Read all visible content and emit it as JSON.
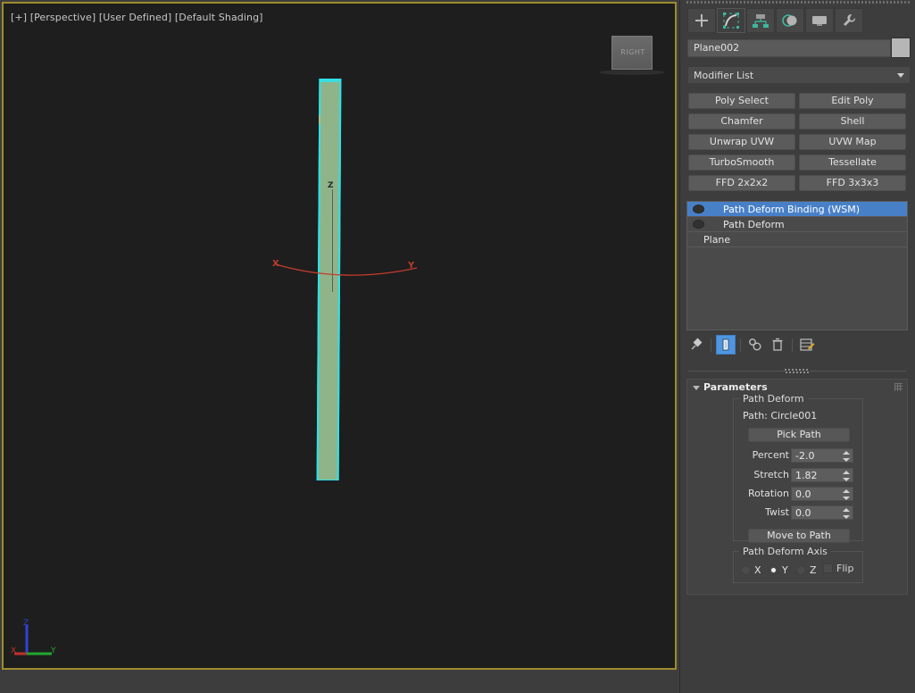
{
  "viewport": {
    "label": "[+] [Perspective] [User Defined] [Default Shading]",
    "view_cube_label": "RIGHT",
    "axis_x_label": "X",
    "axis_y_label": "Y",
    "axis_z_label": "Z",
    "world_axis": {
      "x": "X",
      "y": "Y",
      "z": "Z"
    },
    "colors": {
      "background": "#1e1e1e",
      "active_border": "#9d8b2e",
      "selection_outline": "#28e4ee",
      "object_fill": "#8fb489",
      "path_curve": "#c33b2e"
    }
  },
  "command_panel": {
    "tabs": [
      {
        "name": "create-tab",
        "icon": "plus-icon",
        "active": false
      },
      {
        "name": "modify-tab",
        "icon": "modify-arc-icon",
        "active": true
      },
      {
        "name": "hierarchy-tab",
        "icon": "hierarchy-icon",
        "active": false
      },
      {
        "name": "motion-tab",
        "icon": "motion-wheel-icon",
        "active": false
      },
      {
        "name": "display-tab",
        "icon": "display-monitor-icon",
        "active": false
      },
      {
        "name": "utilities-tab",
        "icon": "wrench-icon",
        "active": false
      }
    ],
    "object_name": "Plane002",
    "object_color": "#b6b6b6",
    "modifier_list_label": "Modifier List",
    "modifier_buttons": [
      "Poly Select",
      "Edit Poly",
      "Chamfer",
      "Shell",
      "Unwrap UVW",
      "UVW Map",
      "TurboSmooth",
      "Tessellate",
      "FFD 2x2x2",
      "FFD 3x3x3"
    ],
    "modifier_stack": [
      {
        "label": "Path Deform Binding (WSM)",
        "selected": true,
        "has_toggle": true,
        "indent": true
      },
      {
        "label": "Path Deform",
        "selected": false,
        "has_toggle": true,
        "indent": true
      },
      {
        "label": "Plane",
        "selected": false,
        "has_toggle": false,
        "indent": false
      }
    ],
    "stack_toolbar": [
      {
        "name": "pin-stack-icon",
        "active": false
      },
      {
        "name": "show-end-result-icon",
        "active": true
      },
      {
        "name": "make-unique-icon",
        "active": false
      },
      {
        "name": "remove-modifier-icon",
        "active": false
      },
      {
        "name": "configure-modifier-sets-icon",
        "active": false
      }
    ]
  },
  "parameters": {
    "rollout_title": "Parameters",
    "path_deform_group": "Path Deform",
    "path_label": "Path: Circle001",
    "pick_path_label": "Pick Path",
    "move_to_path_label": "Move to Path",
    "fields": [
      {
        "label": "Percent",
        "value": "-2.0"
      },
      {
        "label": "Stretch",
        "value": "1.82"
      },
      {
        "label": "Rotation",
        "value": "0.0"
      },
      {
        "label": "Twist",
        "value": "0.0"
      }
    ],
    "axis_group": "Path Deform Axis",
    "axis_options": [
      {
        "label": "X",
        "selected": false
      },
      {
        "label": "Y",
        "selected": true
      },
      {
        "label": "Z",
        "selected": false
      }
    ],
    "flip_label": "Flip",
    "flip_checked": false
  }
}
